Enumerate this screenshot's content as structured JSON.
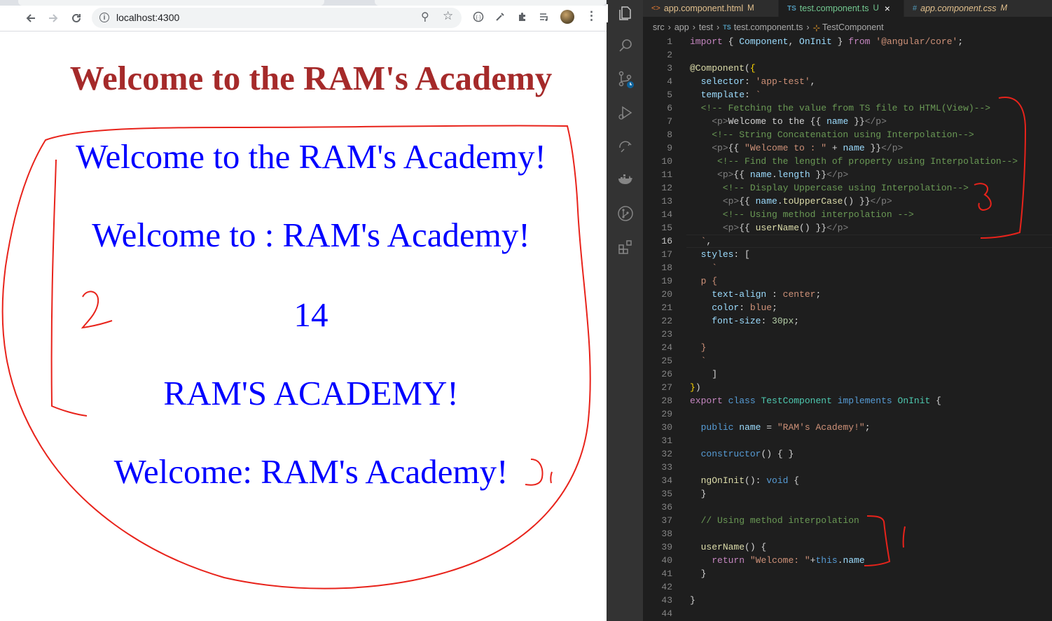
{
  "browser": {
    "url": "localhost:4300",
    "page": {
      "heading": "Welcome to the RAM's Academy",
      "paragraphs": [
        "Welcome to the RAM's Academy!",
        "Welcome to : RAM's Academy!",
        "14",
        "RAM'S ACADEMY!",
        "Welcome: RAM's Academy!"
      ]
    },
    "annotations": {
      "box_number": "2",
      "side_number": "1"
    }
  },
  "editor": {
    "tabs": [
      {
        "label": "app.component.html",
        "badge": "M",
        "icon": "html-file-icon"
      },
      {
        "label": "test.component.ts",
        "badge": "U",
        "icon": "ts-file-icon",
        "active": true,
        "close": "×"
      },
      {
        "label": "app.component.css",
        "badge": "M",
        "icon": "css-file-icon"
      }
    ],
    "breadcrumb": [
      "src",
      "app",
      "test",
      "test.component.ts",
      "TestComponent"
    ],
    "breadcrumb_icons": {
      "ts": "TS",
      "class": "⊹"
    },
    "annotations": {
      "template_number": "3",
      "method_number": "1"
    },
    "current_line": 16,
    "lines": [
      [
        [
          "c-kw2",
          "import"
        ],
        [
          "c-plain",
          " { "
        ],
        [
          "c-var",
          "Component"
        ],
        [
          "c-plain",
          ", "
        ],
        [
          "c-var",
          "OnInit"
        ],
        [
          "c-plain",
          " } "
        ],
        [
          "c-kw2",
          "from"
        ],
        [
          "c-plain",
          " "
        ],
        [
          "c-str",
          "'@angular/core'"
        ],
        [
          "c-plain",
          ";"
        ]
      ],
      [],
      [
        [
          "c-dec",
          "@Component"
        ],
        [
          "c-plain",
          "("
        ],
        [
          "c-brk",
          "{"
        ]
      ],
      [
        [
          "c-plain",
          "  "
        ],
        [
          "c-var",
          "selector"
        ],
        [
          "c-plain",
          ": "
        ],
        [
          "c-str",
          "'app-test'"
        ],
        [
          "c-plain",
          ","
        ]
      ],
      [
        [
          "c-plain",
          "  "
        ],
        [
          "c-var",
          "template"
        ],
        [
          "c-plain",
          ": "
        ],
        [
          "c-str",
          "`"
        ]
      ],
      [
        [
          "c-com",
          "  <!-- Fetching the value from TS file to HTML(View)-->"
        ]
      ],
      [
        [
          "c-plain",
          "    "
        ],
        [
          "c-tag",
          "<p>"
        ],
        [
          "c-plain",
          "Welcome to the {{ "
        ],
        [
          "c-var",
          "name"
        ],
        [
          "c-plain",
          " }}"
        ],
        [
          "c-tag",
          "</p>"
        ]
      ],
      [
        [
          "c-com",
          "    <!-- String Concatenation using Interpolation-->"
        ]
      ],
      [
        [
          "c-plain",
          "    "
        ],
        [
          "c-tag",
          "<p>"
        ],
        [
          "c-plain",
          "{{ "
        ],
        [
          "c-str",
          "\"Welcome to : \""
        ],
        [
          "c-plain",
          " + "
        ],
        [
          "c-var",
          "name"
        ],
        [
          "c-plain",
          " }}"
        ],
        [
          "c-tag",
          "</p>"
        ]
      ],
      [
        [
          "c-com",
          "     <!-- Find the length of property using Interpolation-->"
        ]
      ],
      [
        [
          "c-plain",
          "     "
        ],
        [
          "c-tag",
          "<p>"
        ],
        [
          "c-plain",
          "{{ "
        ],
        [
          "c-var",
          "name"
        ],
        [
          "c-plain",
          "."
        ],
        [
          "c-var",
          "length"
        ],
        [
          "c-plain",
          " }}"
        ],
        [
          "c-tag",
          "</p>"
        ]
      ],
      [
        [
          "c-com",
          "      <!-- Display Uppercase using Interpolation-->"
        ]
      ],
      [
        [
          "c-plain",
          "      "
        ],
        [
          "c-tag",
          "<p>"
        ],
        [
          "c-plain",
          "{{ "
        ],
        [
          "c-var",
          "name"
        ],
        [
          "c-plain",
          "."
        ],
        [
          "c-fn",
          "toUpperCase"
        ],
        [
          "c-plain",
          "() }}"
        ],
        [
          "c-tag",
          "</p>"
        ]
      ],
      [
        [
          "c-com",
          "      <!-- Using method interpolation -->"
        ]
      ],
      [
        [
          "c-plain",
          "      "
        ],
        [
          "c-tag",
          "<p>"
        ],
        [
          "c-plain",
          "{{ "
        ],
        [
          "c-fn",
          "userName"
        ],
        [
          "c-plain",
          "() }}"
        ],
        [
          "c-tag",
          "</p>"
        ]
      ],
      [
        [
          "c-str",
          "  `"
        ],
        [
          "c-plain",
          ","
        ]
      ],
      [
        [
          "c-plain",
          "  "
        ],
        [
          "c-var",
          "styles"
        ],
        [
          "c-plain",
          ": ["
        ]
      ],
      [
        [
          "c-str",
          "    `"
        ]
      ],
      [
        [
          "c-str",
          "  p {"
        ]
      ],
      [
        [
          "c-plain",
          "    "
        ],
        [
          "c-var",
          "text-align"
        ],
        [
          "c-plain",
          " : "
        ],
        [
          "c-str",
          "center"
        ],
        [
          "c-plain",
          ";"
        ]
      ],
      [
        [
          "c-plain",
          "    "
        ],
        [
          "c-var",
          "color"
        ],
        [
          "c-plain",
          ": "
        ],
        [
          "c-str",
          "blue"
        ],
        [
          "c-plain",
          ";"
        ]
      ],
      [
        [
          "c-plain",
          "    "
        ],
        [
          "c-var",
          "font-size"
        ],
        [
          "c-plain",
          ": "
        ],
        [
          "c-num",
          "30px"
        ],
        [
          "c-plain",
          ";"
        ]
      ],
      [],
      [
        [
          "c-str",
          "  }"
        ]
      ],
      [
        [
          "c-str",
          "  `"
        ]
      ],
      [
        [
          "c-plain",
          "    ]"
        ]
      ],
      [
        [
          "c-brk",
          "}"
        ],
        [
          "c-plain",
          ")"
        ]
      ],
      [
        [
          "c-kw2",
          "export"
        ],
        [
          "c-plain",
          " "
        ],
        [
          "c-kw",
          "class"
        ],
        [
          "c-plain",
          " "
        ],
        [
          "c-cls",
          "TestComponent"
        ],
        [
          "c-plain",
          " "
        ],
        [
          "c-kw",
          "implements"
        ],
        [
          "c-plain",
          " "
        ],
        [
          "c-cls",
          "OnInit"
        ],
        [
          "c-plain",
          " {"
        ]
      ],
      [],
      [
        [
          "c-plain",
          "  "
        ],
        [
          "c-kw",
          "public"
        ],
        [
          "c-plain",
          " "
        ],
        [
          "c-var",
          "name"
        ],
        [
          "c-plain",
          " = "
        ],
        [
          "c-str",
          "\"RAM's Academy!\""
        ],
        [
          "c-plain",
          ";"
        ]
      ],
      [],
      [
        [
          "c-plain",
          "  "
        ],
        [
          "c-kw",
          "constructor"
        ],
        [
          "c-plain",
          "() { }"
        ]
      ],
      [],
      [
        [
          "c-plain",
          "  "
        ],
        [
          "c-fn",
          "ngOnInit"
        ],
        [
          "c-plain",
          "(): "
        ],
        [
          "c-kw",
          "void"
        ],
        [
          "c-plain",
          " {"
        ]
      ],
      [
        [
          "c-plain",
          "  }"
        ]
      ],
      [],
      [
        [
          "c-com",
          "  // Using method interpolation"
        ]
      ],
      [],
      [
        [
          "c-plain",
          "  "
        ],
        [
          "c-fn",
          "userName"
        ],
        [
          "c-plain",
          "() {"
        ]
      ],
      [
        [
          "c-plain",
          "    "
        ],
        [
          "c-kw2",
          "return"
        ],
        [
          "c-plain",
          " "
        ],
        [
          "c-str",
          "\"Welcome: \""
        ],
        [
          "c-plain",
          "+"
        ],
        [
          "c-kw",
          "this"
        ],
        [
          "c-plain",
          "."
        ],
        [
          "c-var",
          "name"
        ]
      ],
      [
        [
          "c-plain",
          "  }"
        ]
      ],
      [],
      [
        [
          "c-plain",
          "}"
        ]
      ],
      []
    ]
  }
}
